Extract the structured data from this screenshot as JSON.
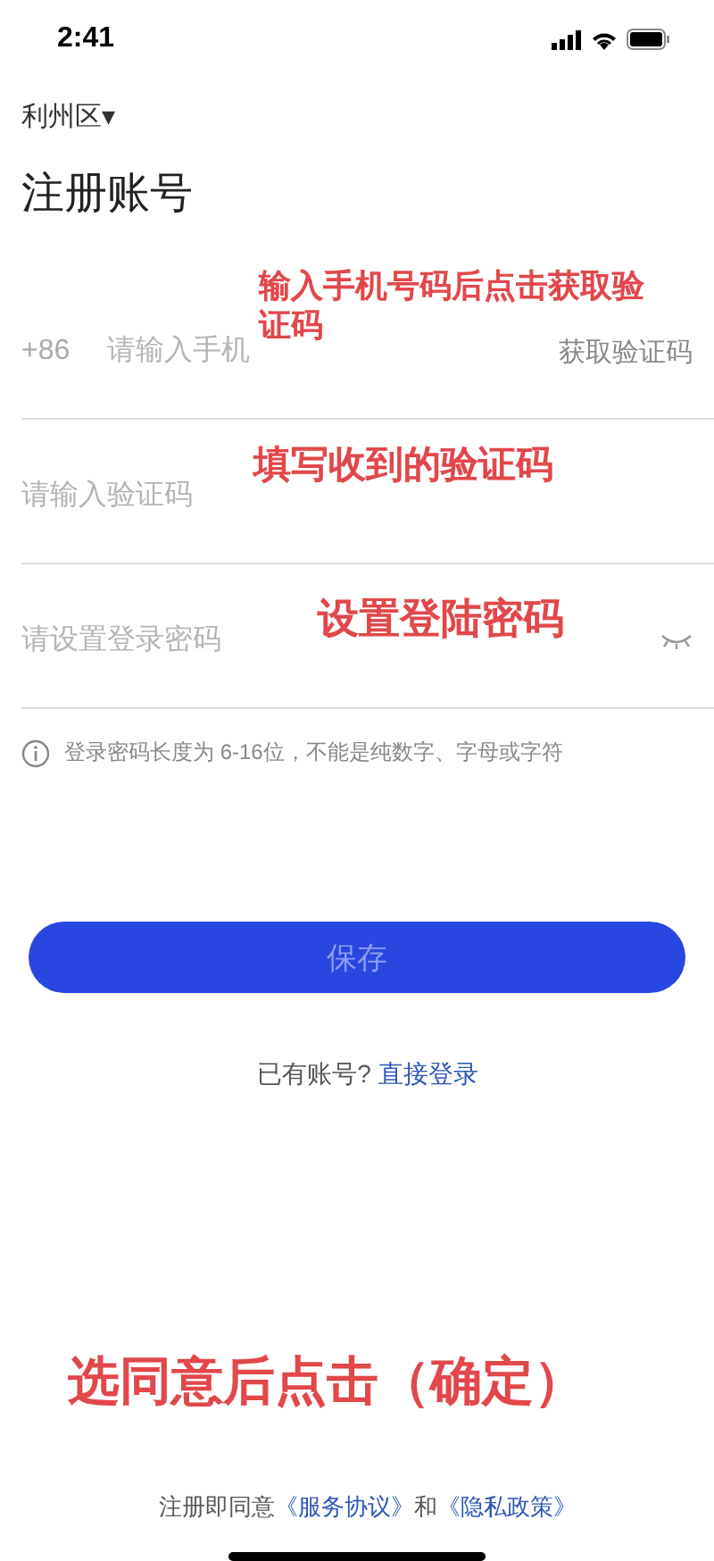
{
  "status_bar": {
    "time": "2:41"
  },
  "region": {
    "label": "利州区",
    "caret": "▾"
  },
  "title": "注册账号",
  "fields": [
    {
      "kind": "phone",
      "prefix": "+86",
      "placeholder": "请输入手机",
      "action": "获取验证码"
    },
    {
      "kind": "code",
      "placeholder": "请输入验证码"
    },
    {
      "kind": "password",
      "placeholder": "请设置登录密码",
      "password_hidden": true
    }
  ],
  "hint": "登录密码长度为 6-16位，不能是纯数字、字母或字符",
  "save_button": {
    "label": "保存",
    "disabled": true
  },
  "login_prompt": {
    "text": "已有账号?",
    "link": "直接登录"
  },
  "agreement": {
    "text": "注册即同意",
    "links": [
      "《服务协议》",
      "《隐私政策》"
    ],
    "joiner": "和"
  },
  "annotations": [
    {
      "text": "输入手机号码后点击获取验证码"
    },
    {
      "text": "填写收到的验证码"
    },
    {
      "text": "设置登陆密码"
    },
    {
      "text": "选同意后点击（确定）"
    }
  ]
}
